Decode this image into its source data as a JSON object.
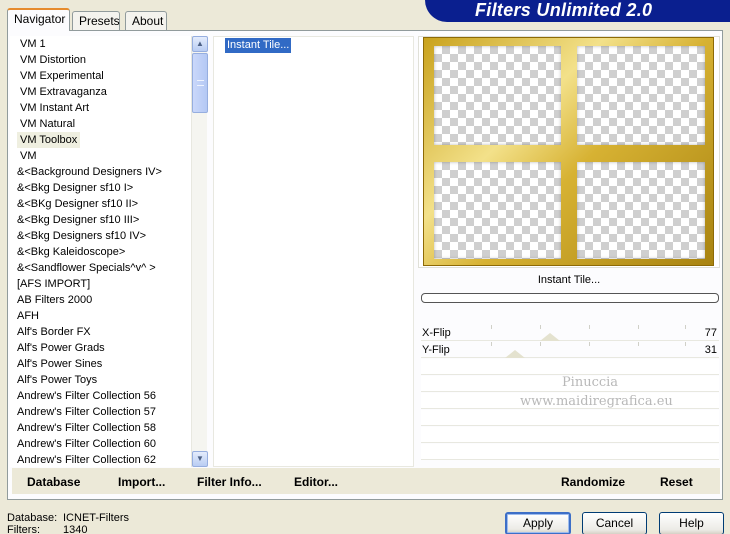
{
  "window": {
    "title": "Filters Unlimited 2.0"
  },
  "tabs": [
    {
      "label": "Navigator",
      "active": true
    },
    {
      "label": "Presets",
      "active": false
    },
    {
      "label": "About",
      "active": false
    }
  ],
  "filter_list": {
    "selected": "VM Toolbox",
    "items": [
      "VM 1",
      "VM Distortion",
      "VM Experimental",
      "VM Extravaganza",
      "VM Instant Art",
      "VM Natural",
      "VM Toolbox",
      "VM",
      "&<Background Designers IV>",
      "&<Bkg Designer sf10 I>",
      "&<BKg Designer sf10 II>",
      "&<Bkg Designer sf10 III>",
      "&<Bkg Designers sf10 IV>",
      "&<Bkg Kaleidoscope>",
      "&<Sandflower Specials^v^ >",
      "[AFS IMPORT]",
      "AB Filters 2000",
      "AFH",
      "Alf's Border FX",
      "Alf's Power Grads",
      "Alf's Power Sines",
      "Alf's Power Toys",
      "Andrew's Filter Collection 56",
      "Andrew's Filter Collection 57",
      "Andrew's Filter Collection 58",
      "Andrew's Filter Collection 60",
      "Andrew's Filter Collection 62"
    ]
  },
  "effect_list": {
    "items": [
      "Instant Tile..."
    ],
    "selected": "Instant Tile..."
  },
  "preview": {
    "caption": "Instant Tile...",
    "progress": 0
  },
  "sliders": [
    {
      "label": "X-Flip",
      "value": "77",
      "max": 255
    },
    {
      "label": "Y-Flip",
      "value": "31",
      "max": 255
    }
  ],
  "watermark": {
    "line1": "Pinuccia",
    "line2": "www.maidiregrafica.eu"
  },
  "bottom_links": {
    "database": "Database",
    "import": "Import...",
    "filter_info": "Filter Info...",
    "editor": "Editor...",
    "randomize": "Randomize",
    "reset": "Reset"
  },
  "footer": {
    "database_label": "Database:",
    "database_value": "ICNET-Filters",
    "filters_label": "Filters:",
    "filters_value": "1340",
    "apply": "Apply",
    "cancel": "Cancel",
    "help": "Help"
  },
  "colors": {
    "selection": "#316ac5",
    "banner": "#0a1f8f",
    "active_tab_accent": "#e68b2c",
    "preview_frame": "#d7b233"
  },
  "icons": {
    "scroll_up": "arrow-up-icon",
    "scroll_down": "arrow-down-icon"
  }
}
